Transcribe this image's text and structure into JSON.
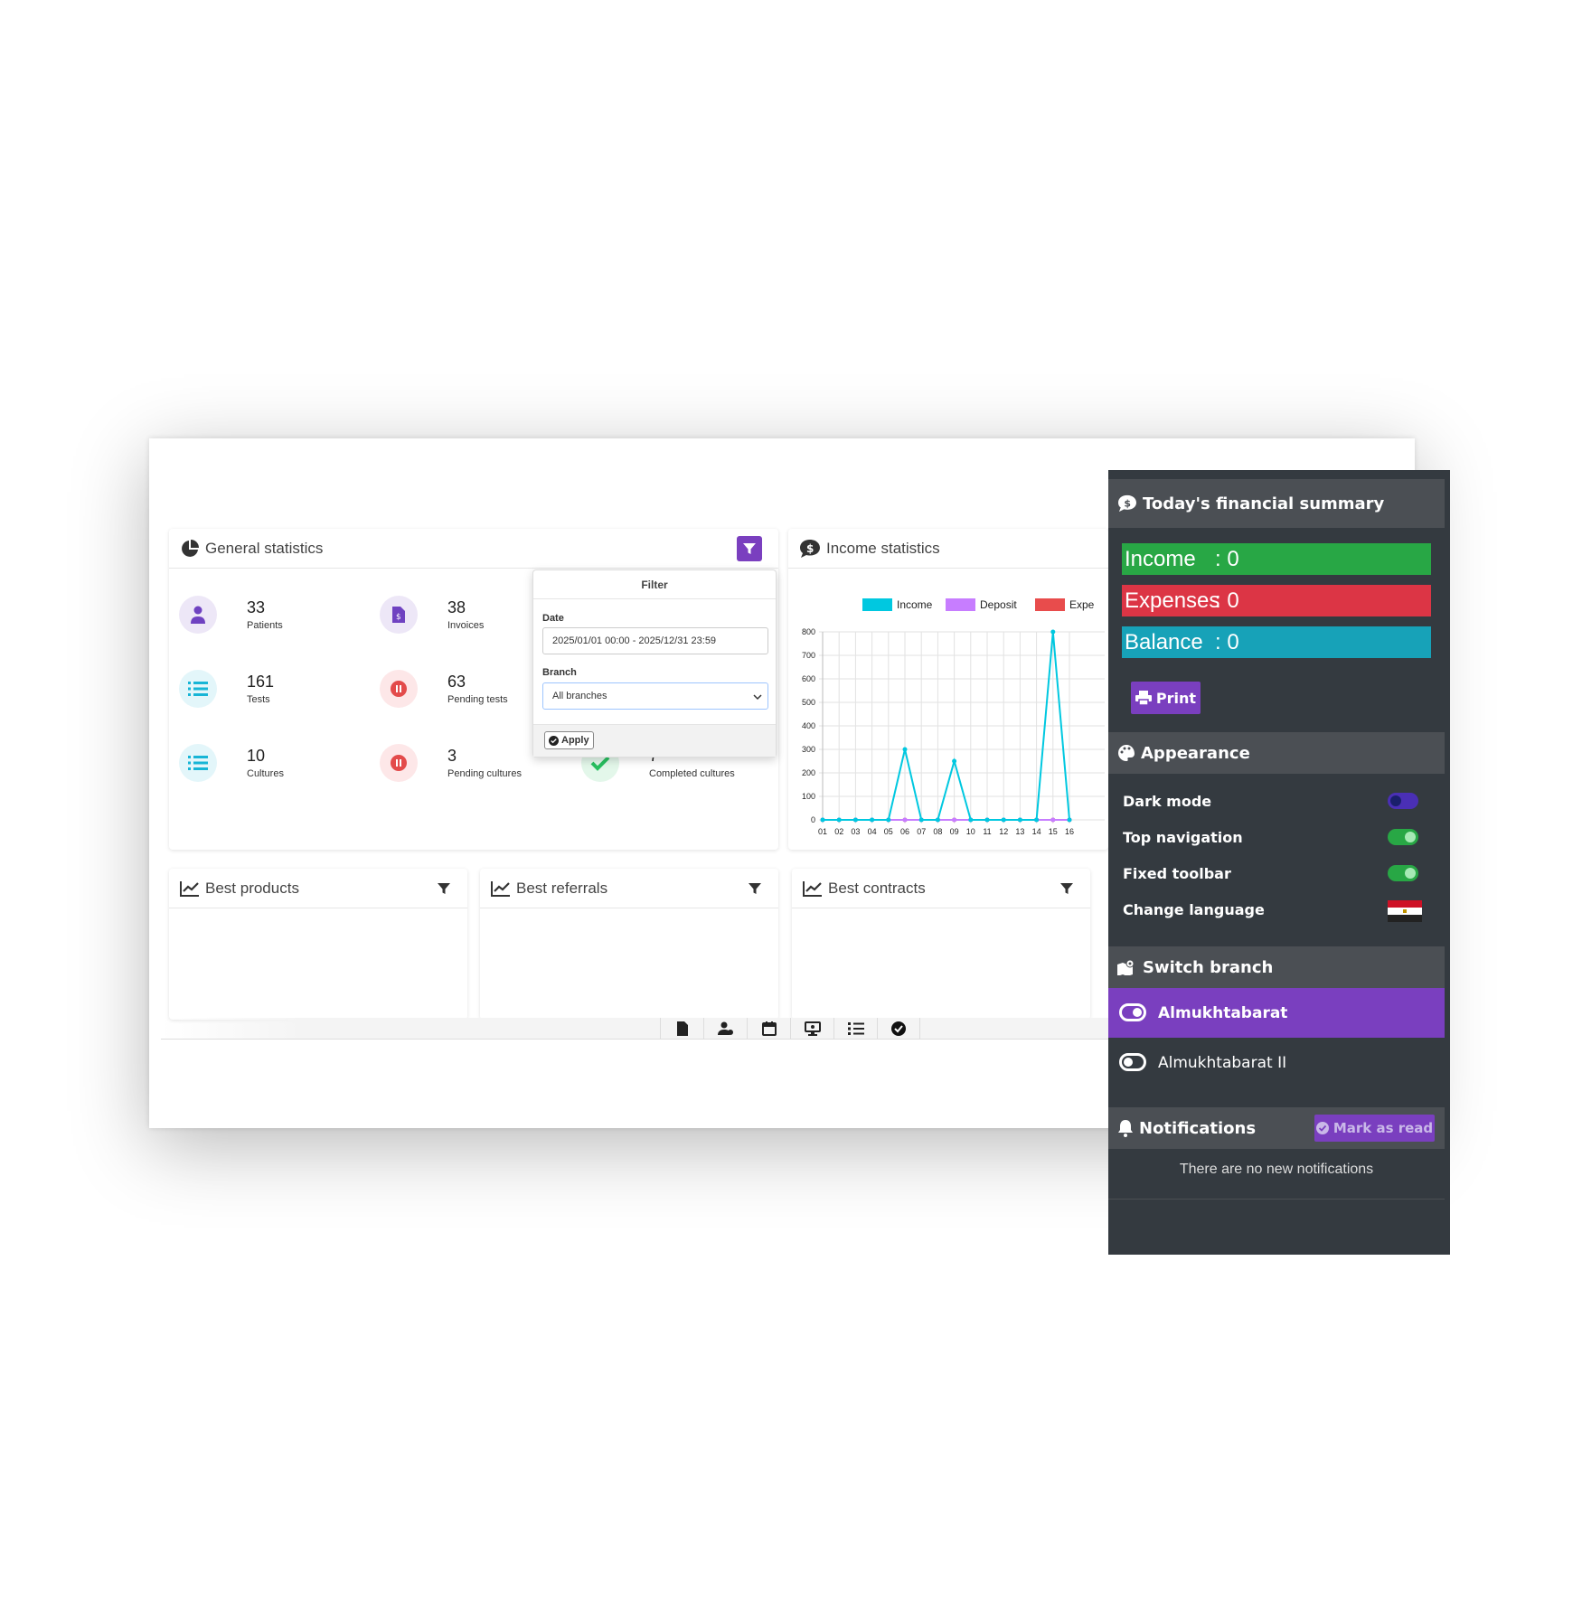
{
  "general": {
    "title": "General statistics",
    "stats": [
      {
        "value": "33",
        "label": "Patients",
        "icon": "patient-icon"
      },
      {
        "value": "38",
        "label": "Invoices",
        "icon": "invoice-icon"
      },
      {
        "value": "161",
        "label": "Tests",
        "icon": "list-icon"
      },
      {
        "value": "63",
        "label": "Pending tests",
        "icon": "pause-icon"
      },
      {
        "value": "10",
        "label": "Cultures",
        "icon": "list-icon"
      },
      {
        "value": "3",
        "label": "Pending cultures",
        "icon": "pause-icon"
      },
      {
        "value": "7",
        "label": "Completed cultures",
        "icon": "check-icon"
      }
    ]
  },
  "filter": {
    "title": "Filter",
    "date_label": "Date",
    "date_value": "2025/01/01 00:00 - 2025/12/31 23:59",
    "branch_label": "Branch",
    "branch_value": "All branches",
    "apply_label": "Apply"
  },
  "income": {
    "title": "Income statistics"
  },
  "chart_data": {
    "type": "line",
    "categories": [
      "01",
      "02",
      "03",
      "04",
      "05",
      "06",
      "07",
      "08",
      "09",
      "10",
      "11",
      "12",
      "13",
      "14",
      "15",
      "16"
    ],
    "series": [
      {
        "name": "Income",
        "color": "#00c8e0",
        "values": [
          0,
          0,
          0,
          0,
          0,
          300,
          0,
          0,
          250,
          0,
          0,
          0,
          0,
          0,
          800,
          0
        ]
      },
      {
        "name": "Deposit",
        "color": "#c77dff",
        "values": [
          0,
          0,
          0,
          0,
          0,
          0,
          0,
          0,
          0,
          0,
          0,
          0,
          0,
          0,
          0,
          0
        ]
      },
      {
        "name": "Expe",
        "color": "#e84c4c",
        "values": [
          0,
          0,
          0,
          0,
          0,
          0,
          0,
          0,
          0,
          0,
          0,
          0,
          0,
          0,
          0,
          0
        ]
      }
    ],
    "y_ticks": [
      "0",
      "100",
      "200",
      "300",
      "400",
      "500",
      "600",
      "700",
      "800"
    ],
    "ylim": [
      0,
      800
    ],
    "grid": true,
    "legend": "top"
  },
  "cards": {
    "best_products": "Best products",
    "best_referrals": "Best referrals",
    "best_contracts": "Best contracts"
  },
  "panel": {
    "summary_title": "Today's financial summary",
    "income_label": "Income",
    "income_value": ": 0",
    "expenses_label": "Expenses",
    "expenses_value": ": 0",
    "balance_label": "Balance",
    "balance_value": ": 0",
    "print_label": "Print",
    "appearance_title": "Appearance",
    "dark_mode": "Dark mode",
    "top_navigation": "Top navigation",
    "fixed_toolbar": "Fixed toolbar",
    "change_language": "Change language",
    "switch_branch_title": "Switch branch",
    "branches": [
      "Almukhtabarat",
      "Almukhtabarat II"
    ],
    "notifications_title": "Notifications",
    "mark_as_read": "Mark as read",
    "no_notifications": "There are no new notifications"
  },
  "colors": {
    "accent": "#7a3fbf",
    "income": "#28a745",
    "expenses": "#dc3545",
    "balance": "#17a2b8",
    "panel_bg": "#343a40"
  },
  "toolbar": {
    "icons": [
      "document-icon",
      "user-gear-icon",
      "calendar-icon",
      "monitor-icon",
      "list-check-icon",
      "check-circle-icon"
    ]
  }
}
